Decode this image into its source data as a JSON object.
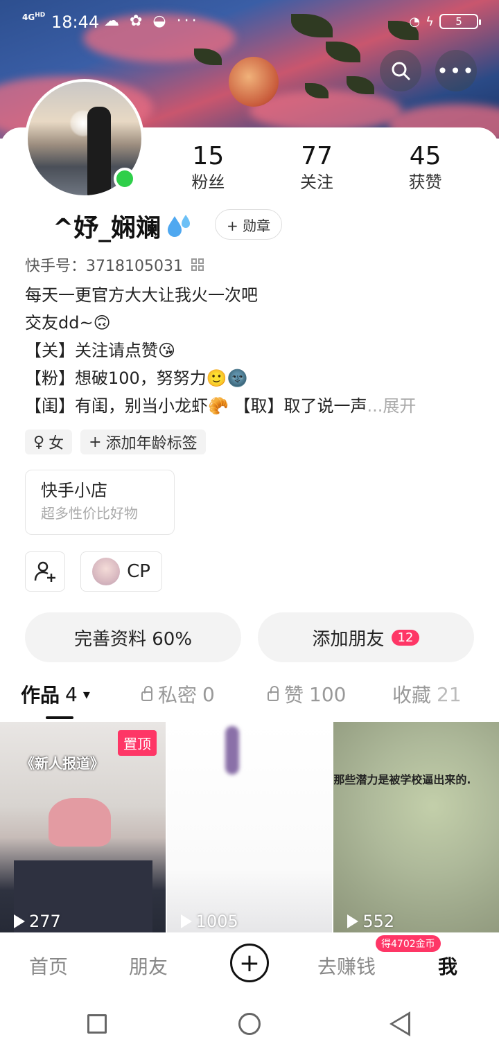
{
  "status_bar": {
    "network": "4G",
    "network_sub": "HD",
    "time": "18:44",
    "icons": "☁ ✿ ◒ ···",
    "battery": "5"
  },
  "header": {
    "search_icon": "search-icon",
    "more_icon": "more-dots-icon"
  },
  "profile": {
    "username": "^妤_娴斓",
    "badge_label": "+ 勋章",
    "ks_id_label": "快手号：3718105031",
    "stats": [
      {
        "num": "15",
        "label": "粉丝"
      },
      {
        "num": "77",
        "label": "关注"
      },
      {
        "num": "45",
        "label": "获赞"
      }
    ],
    "bio_lines": [
      "每天一更官方大大让我火一次吧",
      "交友dd~🙃",
      "【关】关注请点赞😘",
      "【粉】想破100，努努力🙂🌚",
      "【闺】有闺，别当小龙虾🥐 【取】取了说一声"
    ],
    "bio_more": "...展开",
    "tags": [
      {
        "icon": "♀",
        "label": "女"
      },
      {
        "icon": "+",
        "label": "添加年龄标签"
      }
    ],
    "shop": {
      "title": "快手小店",
      "subtitle": "超多性价比好物"
    },
    "cp_label": "CP",
    "complete_profile": "完善资料 60%",
    "add_friends": "添加朋友",
    "add_friends_count": "12"
  },
  "tabs": [
    {
      "label": "作品",
      "count": "4",
      "arrow": "▾"
    },
    {
      "label": "私密",
      "count": "0"
    },
    {
      "label": "赞",
      "count": "100"
    },
    {
      "label": "收藏",
      "count": "21"
    }
  ],
  "videos": [
    {
      "plays": "277",
      "pinned": "置顶",
      "caption": "《新人报道》"
    },
    {
      "plays": "1005"
    },
    {
      "plays": "552",
      "caption": "那些潜力是被学校逼出来的."
    }
  ],
  "bottom_nav": {
    "home": "首页",
    "friends": "朋友",
    "earn": "去赚钱",
    "earn_badge": "得4702金币",
    "me": "我"
  },
  "colors": {
    "accent": "#fe3666",
    "online": "#2fcf4a"
  }
}
